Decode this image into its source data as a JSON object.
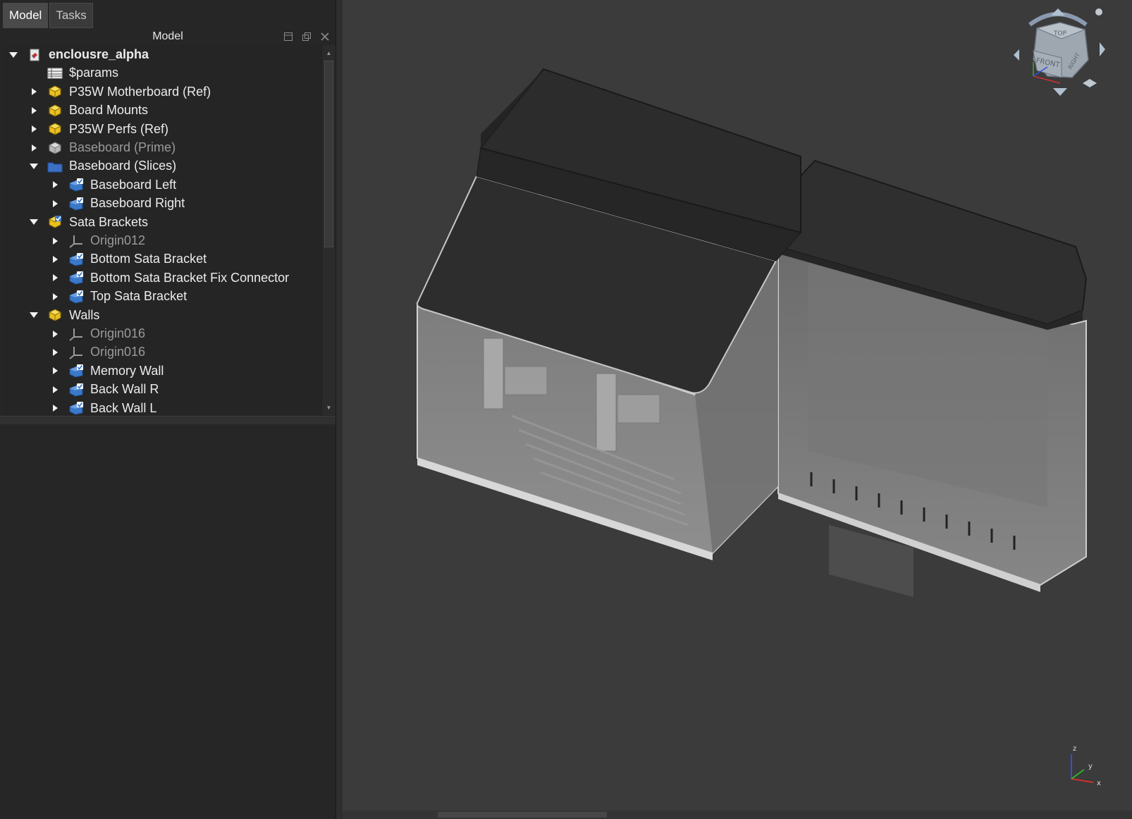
{
  "tabs": [
    {
      "label": "Model",
      "active": true
    },
    {
      "label": "Tasks",
      "active": false
    }
  ],
  "panel": {
    "title": "Model"
  },
  "tree": [
    {
      "label": "enclousre_alpha",
      "depth": 0,
      "expanded": true,
      "icon": "document-icon",
      "bold": true
    },
    {
      "label": "$params",
      "depth": 1,
      "expanded": null,
      "icon": "spreadsheet-icon"
    },
    {
      "label": "P35W Motherboard (Ref)",
      "depth": 1,
      "expanded": false,
      "icon": "part-icon"
    },
    {
      "label": "Board Mounts",
      "depth": 1,
      "expanded": false,
      "icon": "part-icon"
    },
    {
      "label": "P35W Perfs (Ref)",
      "depth": 1,
      "expanded": false,
      "icon": "part-icon"
    },
    {
      "label": "Baseboard (Prime)",
      "depth": 1,
      "expanded": false,
      "icon": "part-icon-hidden",
      "dim": true
    },
    {
      "label": "Baseboard (Slices)",
      "depth": 1,
      "expanded": true,
      "icon": "folder-icon"
    },
    {
      "label": "Baseboard Left",
      "depth": 2,
      "expanded": false,
      "icon": "body-icon"
    },
    {
      "label": "Baseboard Right",
      "depth": 2,
      "expanded": false,
      "icon": "body-icon"
    },
    {
      "label": "Sata Brackets",
      "depth": 1,
      "expanded": true,
      "icon": "part-icon-active"
    },
    {
      "label": "Origin012",
      "depth": 2,
      "expanded": false,
      "icon": "origin-icon",
      "dim": true
    },
    {
      "label": "Bottom Sata Bracket",
      "depth": 2,
      "expanded": false,
      "icon": "body-icon"
    },
    {
      "label": "Bottom Sata Bracket Fix Connector",
      "depth": 2,
      "expanded": false,
      "icon": "body-icon"
    },
    {
      "label": "Top Sata Bracket",
      "depth": 2,
      "expanded": false,
      "icon": "body-icon"
    },
    {
      "label": "Walls",
      "depth": 1,
      "expanded": true,
      "icon": "part-icon"
    },
    {
      "label": "Origin016",
      "depth": 2,
      "expanded": false,
      "icon": "origin-icon",
      "dim": true
    },
    {
      "label": "Origin016",
      "depth": 2,
      "expanded": false,
      "icon": "origin-icon",
      "dim": true
    },
    {
      "label": "Memory Wall",
      "depth": 2,
      "expanded": false,
      "icon": "body-icon"
    },
    {
      "label": "Back Wall R",
      "depth": 2,
      "expanded": false,
      "icon": "body-icon"
    },
    {
      "label": "Back Wall L",
      "depth": 2,
      "expanded": false,
      "icon": "body-icon"
    }
  ],
  "navcube": {
    "top": "TOP",
    "front": "FRONT",
    "right": "RIGHT"
  },
  "axes": {
    "z": "z",
    "y": "y",
    "x": "x"
  },
  "colors": {
    "x_axis": "#d03030",
    "y_axis": "#30b030",
    "z_axis": "#3050e0",
    "part_yellow": "#e8c020",
    "body_blue": "#3a78c8"
  }
}
